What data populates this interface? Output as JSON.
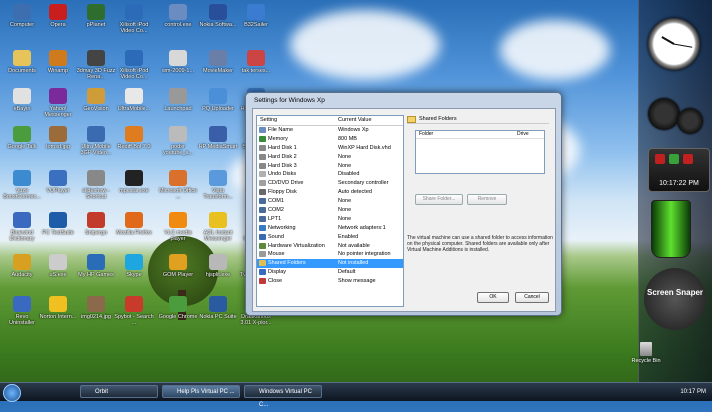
{
  "desktop_icons": [
    {
      "label": "Computer",
      "color": "#3d6fb0"
    },
    {
      "label": "Opera",
      "color": "#c81e1e"
    },
    {
      "label": "pPlanet",
      "color": "#2e6d2e"
    },
    {
      "label": "Xilisoft iPod Video Co...",
      "color": "#2c6bb8"
    },
    {
      "label": "control.exe",
      "color": "#6a8cc0"
    },
    {
      "label": "Nokia Softwa...",
      "color": "#2a4f9a"
    },
    {
      "label": "B32Sailer",
      "color": "#3b7bd0"
    },
    {
      "label": "Documents",
      "color": "#e7c45a"
    },
    {
      "label": "Winamp",
      "color": "#d07a1e"
    },
    {
      "label": "3dmay 3D Fuzz Rena...",
      "color": "#444444"
    },
    {
      "label": "Xilisoft iPod Video Co...",
      "color": "#2c6bb8"
    },
    {
      "label": "wm-2009-1...",
      "color": "#d8d8d8"
    },
    {
      "label": "MovieMaker",
      "color": "#6a7fa8"
    },
    {
      "label": "tak terses...",
      "color": "#cc4444"
    },
    {
      "label": "eBayin",
      "color": "#e1e1e1"
    },
    {
      "label": "Yahoo! Messenger",
      "color": "#7a2a9a"
    },
    {
      "label": "GeoVision",
      "color": "#cf9c3a"
    },
    {
      "label": "UltraMobile...",
      "color": "#e8e8e8"
    },
    {
      "label": "Launchpad",
      "color": "#999999"
    },
    {
      "label": "PQ Uploader",
      "color": "#4b8fd8"
    },
    {
      "label": "HP Help and Support",
      "color": "#3a76c2"
    },
    {
      "label": "Google Talk",
      "color": "#4a9c3c"
    },
    {
      "label": "tomsd.jpg",
      "color": "#9c6b3a"
    },
    {
      "label": "Ultra Mobile 3GP Video...",
      "color": "#3a6ab0"
    },
    {
      "label": "Rediff Bol 7.0",
      "color": "#e07c20"
    },
    {
      "label": "podsr youtube_a...",
      "color": "#bbbbbb"
    },
    {
      "label": "HP MediaSmart",
      "color": "#3a5ea8"
    },
    {
      "label": "BjornyJ.jpg",
      "color": "#a05a2c"
    },
    {
      "label": "Vuze BoostConnec...",
      "color": "#3c8ad0"
    },
    {
      "label": "VUPlayer",
      "color": "#3b6fc0"
    },
    {
      "label": "slideshow - Shortcut",
      "color": "#888888"
    },
    {
      "label": "mpcstar.exe",
      "color": "#222222"
    },
    {
      "label": "Microsoft Office ...",
      "color": "#d9712c"
    },
    {
      "label": "Vista Transform...",
      "color": "#5a9adc"
    },
    {
      "label": "Phase 3",
      "color": "#6b8f3a"
    },
    {
      "label": "Bluewind Dictionary",
      "color": "#3a6ac0"
    },
    {
      "label": "PC TestSuite",
      "color": "#1c5ca8"
    },
    {
      "label": "Snipergo",
      "color": "#c23a2a"
    },
    {
      "label": "Mozilla Firefox",
      "color": "#e06a1a"
    },
    {
      "label": "VLC media player",
      "color": "#f08a10"
    },
    {
      "label": "AOL Instant Messenger",
      "color": "#e8c020"
    },
    {
      "label": "Adobe Cybersh...",
      "color": "#3a5aa0"
    },
    {
      "label": "Audacity",
      "color": "#d8a020"
    },
    {
      "label": "uS.exe",
      "color": "#cccccc"
    },
    {
      "label": "My HP Games",
      "color": "#2a6cb8"
    },
    {
      "label": "Skype",
      "color": "#1ea6e0"
    },
    {
      "label": "GOM Player",
      "color": "#e0a020"
    },
    {
      "label": "hjsplit.exe",
      "color": "#b8b8b8"
    },
    {
      "label": "TvantsSetu...",
      "color": "#5c9c2c"
    },
    {
      "label": "Revo Uninstaller",
      "color": "#3a6ac0"
    },
    {
      "label": "Norton Intern...",
      "color": "#f0c020"
    },
    {
      "label": "img0214.jpg",
      "color": "#8a6a4a"
    },
    {
      "label": "Spybot - Search ...",
      "color": "#c83a2a"
    },
    {
      "label": "Google Chrome",
      "color": "#4a9c3c"
    },
    {
      "label": "Nokia PC Suite",
      "color": "#2a5aa0"
    },
    {
      "label": "Draakarious 3.01 X-plor...",
      "color": "#2a6c8a"
    }
  ],
  "window": {
    "title": "Settings for Windows Xp",
    "columns": {
      "setting": "Setting",
      "value": "Current Value"
    },
    "rows": [
      {
        "setting": "File Name",
        "value": "Windows Xp",
        "color": "#6a8cc0"
      },
      {
        "setting": "Memory",
        "value": "800 MB",
        "color": "#3a8a3a"
      },
      {
        "setting": "Hard Disk 1",
        "value": "WinXP Hard Disk.vhd",
        "color": "#888888"
      },
      {
        "setting": "Hard Disk 2",
        "value": "None",
        "color": "#888888"
      },
      {
        "setting": "Hard Disk 3",
        "value": "None",
        "color": "#888888"
      },
      {
        "setting": "Undo Disks",
        "value": "Disabled",
        "color": "#b0b0b0"
      },
      {
        "setting": "CD/DVD Drive",
        "value": "Secondary controller",
        "color": "#a0a0a0"
      },
      {
        "setting": "Floppy Disk",
        "value": "Auto detected",
        "color": "#6a6a6a"
      },
      {
        "setting": "COM1",
        "value": "None",
        "color": "#4a6a9a"
      },
      {
        "setting": "COM2",
        "value": "None",
        "color": "#4a6a9a"
      },
      {
        "setting": "LPT1",
        "value": "None",
        "color": "#4a6a9a"
      },
      {
        "setting": "Networking",
        "value": "Network adapters:1",
        "color": "#3a7ac0"
      },
      {
        "setting": "Sound",
        "value": "Enabled",
        "color": "#3a6ab0"
      },
      {
        "setting": "Hardware Virtualization",
        "value": "Not available",
        "color": "#5a8a3a"
      },
      {
        "setting": "Mouse",
        "value": "No pointer integration",
        "color": "#9a9a9a"
      },
      {
        "setting": "Shared Folders",
        "value": "Not installed",
        "color": "#e0c050"
      },
      {
        "setting": "Display",
        "value": "Default",
        "color": "#3a6ac0"
      },
      {
        "setting": "Close",
        "value": "Show message",
        "color": "#c03a3a"
      }
    ],
    "selected_index": 15,
    "shared_folders": {
      "header": "Shared Folders",
      "col_folder": "Folder",
      "col_drive": "Drive",
      "share_btn": "Share Folder...",
      "remove_btn": "Remove",
      "info": "The virtual machine can use a shared folder to access information on the physical computer. Shared folders are available only after Virtual Machine Additions is installed."
    },
    "ok": "OK",
    "cancel": "Cancel"
  },
  "sidebar": {
    "digital_time": "10:17:22 PM",
    "snapper": "Screen Snaper",
    "recycle": "Recycle Bin"
  },
  "taskbar": {
    "tasks": [
      "Orbit",
      "Help Pls Virtual PC ...",
      "Windows Virtual PC C..."
    ],
    "time": "10:17 PM"
  }
}
